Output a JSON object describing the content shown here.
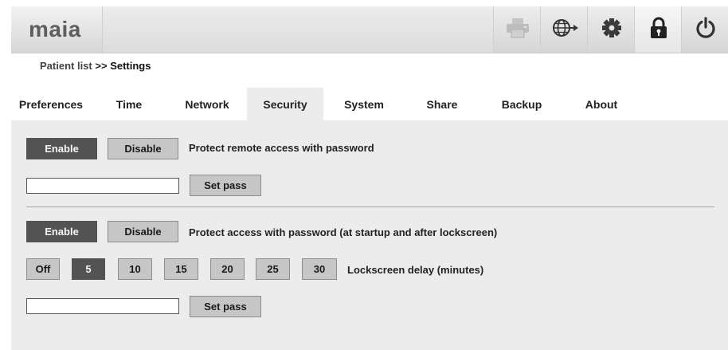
{
  "app": {
    "logo": "maia"
  },
  "toolbar": {
    "icons": [
      "printer-icon",
      "network-globe-icon",
      "settings-gear-icon",
      "lock-icon",
      "power-icon"
    ]
  },
  "breadcrumb": {
    "parent": "Patient list",
    "separator": ">>",
    "current": "Settings"
  },
  "tabs": [
    {
      "label": "Preferences"
    },
    {
      "label": "Time"
    },
    {
      "label": "Network"
    },
    {
      "label": "Security",
      "active": true
    },
    {
      "label": "System"
    },
    {
      "label": "Share"
    },
    {
      "label": "Backup"
    },
    {
      "label": "About"
    }
  ],
  "remote": {
    "enable_label": "Enable",
    "disable_label": "Disable",
    "description": "Protect remote access with password",
    "selected": "Enable",
    "password_value": "",
    "set_pass_label": "Set pass"
  },
  "local": {
    "enable_label": "Enable",
    "disable_label": "Disable",
    "description": "Protect access with password (at startup and after lockscreen)",
    "selected": "Enable",
    "delay_options": [
      "Off",
      "5",
      "10",
      "15",
      "20",
      "25",
      "30"
    ],
    "delay_selected": "5",
    "delay_label": "Lockscreen delay (minutes)",
    "password_value": "",
    "set_pass_label": "Set pass"
  },
  "colors": {
    "selected_button": "#535353",
    "unselected_button": "#c6c6c6",
    "panel_background": "#ececec"
  }
}
